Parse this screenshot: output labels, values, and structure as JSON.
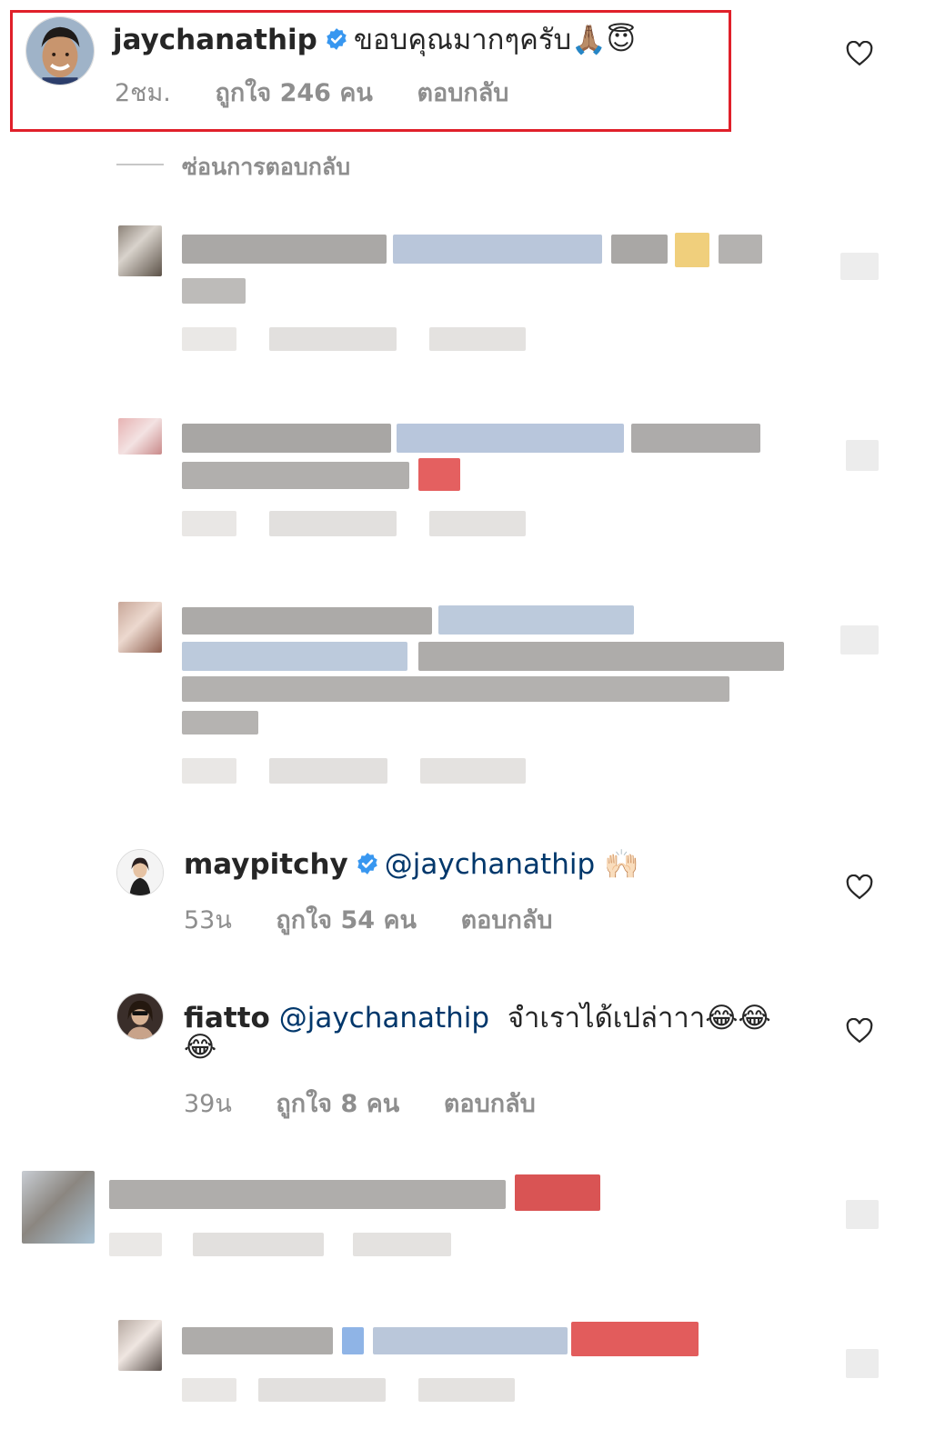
{
  "main_comment": {
    "username": "jaychanathip",
    "verified": true,
    "text": "ขอบคุณมากๆครับ",
    "emojis": [
      "🙏🏽",
      "😇"
    ],
    "time": "2ชม.",
    "likes": "ถูกใจ 246 คน",
    "reply_label": "ตอบกลับ"
  },
  "hide_replies_label": "ซ่อนการตอบกลับ",
  "replies": [
    {
      "username": "maypitchy",
      "verified": true,
      "mention": "@jaychanathip",
      "emoji": "🙌🏻",
      "time": "53น",
      "likes": "ถูกใจ 54 คน",
      "reply_label": "ตอบกลับ"
    },
    {
      "username": "fiatto",
      "mention": "@jaychanathip",
      "text": "จำเราได้เปล่าาา",
      "emoji_line1": "😂😂",
      "emoji_line2": "😂",
      "time": "39น",
      "likes": "ถูกใจ 8 คน",
      "reply_label": "ตอบกลับ"
    }
  ],
  "colors": {
    "highlight": "#e0202a",
    "verified": "#3897f0",
    "mention": "#00376b",
    "meta": "#8e8e8e"
  },
  "icons": [
    "heart-icon",
    "verified-badge-icon",
    "avatar-image"
  ]
}
